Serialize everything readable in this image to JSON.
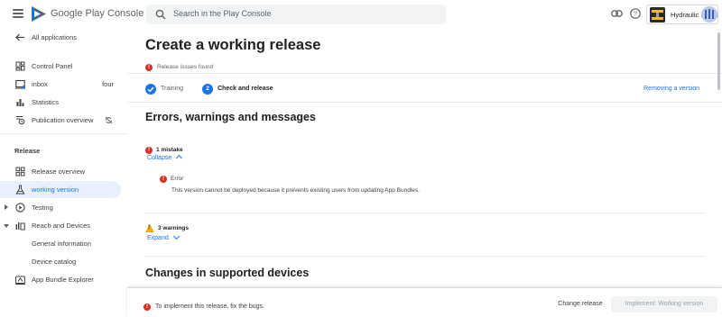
{
  "topbar": {
    "brand_google_play": "Google Play",
    "brand_console": "Console",
    "search_placeholder": "Search in the Play Console",
    "app_name": "Hydraulic Press",
    "icons": [
      "menu-icon",
      "play-console-logo",
      "search-icon",
      "link-icon",
      "help-icon",
      "app-icon",
      "avatar"
    ]
  },
  "sidebar": {
    "back_label": "All applications",
    "items": [
      {
        "label": "Control Panel",
        "icon": "dashboard-icon"
      },
      {
        "label": "inbox",
        "badge": "four",
        "icon": "inbox-icon"
      },
      {
        "label": "Statistics",
        "icon": "bar-chart-icon"
      },
      {
        "label": "Publication overview",
        "icon": "publish-icon",
        "trailing_icon": "sync-off-icon"
      }
    ],
    "release_header": "Release",
    "release_items": [
      {
        "label": "Release overview",
        "icon": "grid-icon"
      },
      {
        "label": "working version",
        "icon": "flask-icon",
        "active": true
      },
      {
        "label": "Testing",
        "icon": "play-circle-icon"
      },
      {
        "label": "Reach and Devices",
        "icon": "devices-icon"
      },
      {
        "label": "General information"
      },
      {
        "label": "Device catalog"
      },
      {
        "label": "App Bundle Explorer",
        "icon": "app-bundle-icon"
      }
    ]
  },
  "main": {
    "title": "Create a working release",
    "issue_text": "Release issues found",
    "steps": [
      {
        "label": "Training",
        "state": "done"
      },
      {
        "number": "2",
        "label": "Check and release",
        "state": "current"
      }
    ],
    "remove_link": "Removing a version",
    "errors_section_title": "Errors, warnings and messages",
    "errors": {
      "count_label": "1 mistake",
      "collapse_label": "Collapse",
      "item_title": "Error",
      "item_description": "This version cannot be deployed because it prevents existing users from updating App Bundles."
    },
    "warnings": {
      "count_label": "3 warnings",
      "expand_label": "Expand"
    },
    "devices_section_title": "Changes in supported devices"
  },
  "bottombar": {
    "message": "To implement this release, fix the bugs.",
    "change_release": "Change release",
    "implement": "Implement: Working version"
  },
  "colors": {
    "accent": "#1a73e8",
    "error": "#d93025",
    "warning": "#f9ab00",
    "active_bg": "#e8f0fe"
  }
}
